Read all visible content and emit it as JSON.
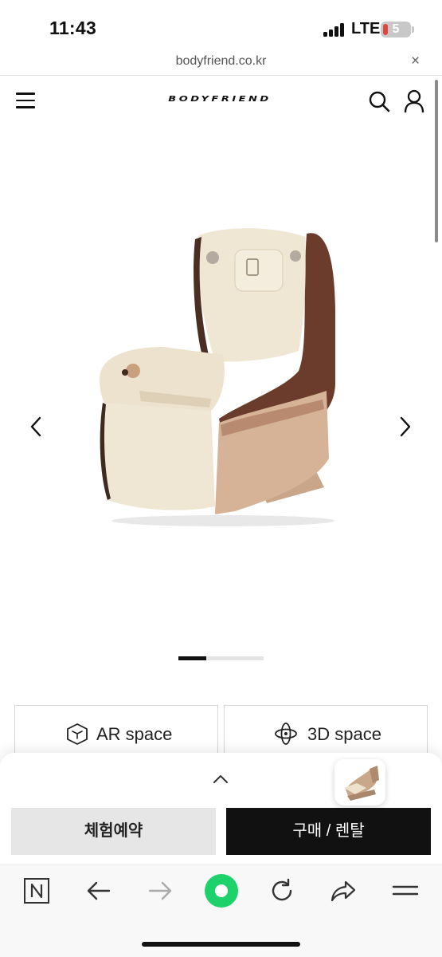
{
  "status_bar": {
    "time": "11:43",
    "network": "LTE",
    "battery_level": "5"
  },
  "url_bar": {
    "url": "bodyfriend.co.kr",
    "close_label": "×"
  },
  "header": {
    "logo_text": "BODYFRIEND",
    "menu_icon": "hamburger-menu-icon",
    "search_icon": "search-icon",
    "account_icon": "user-icon"
  },
  "carousel": {
    "image": "massage-chair-beige-brown",
    "prev_icon": "chevron-left-icon",
    "next_icon": "chevron-right-icon",
    "progress": 0.33
  },
  "features": {
    "ar_label": "AR space",
    "ar_icon": "cube-icon",
    "threed_label": "3D space",
    "threed_icon": "orbit-icon"
  },
  "bottom_sheet": {
    "expand_icon": "chevron-up-icon",
    "thumbnail": "massage-chair-thumbnail",
    "reserve_label": "체험예약",
    "buy_label": "구매 / 렌탈"
  },
  "toolbar": {
    "items": [
      "naver-n-icon",
      "back-arrow-icon",
      "forward-arrow-icon",
      "green-home-icon",
      "refresh-icon",
      "share-icon",
      "menu-lines-icon"
    ]
  },
  "colors": {
    "accent_dark": "#111111",
    "reserve_bg": "#e6e6e6",
    "green_button": "#1ed26b",
    "chair_brown": "#6b3b2c",
    "chair_cream": "#efe6d3",
    "chair_tan": "#d6b296"
  }
}
